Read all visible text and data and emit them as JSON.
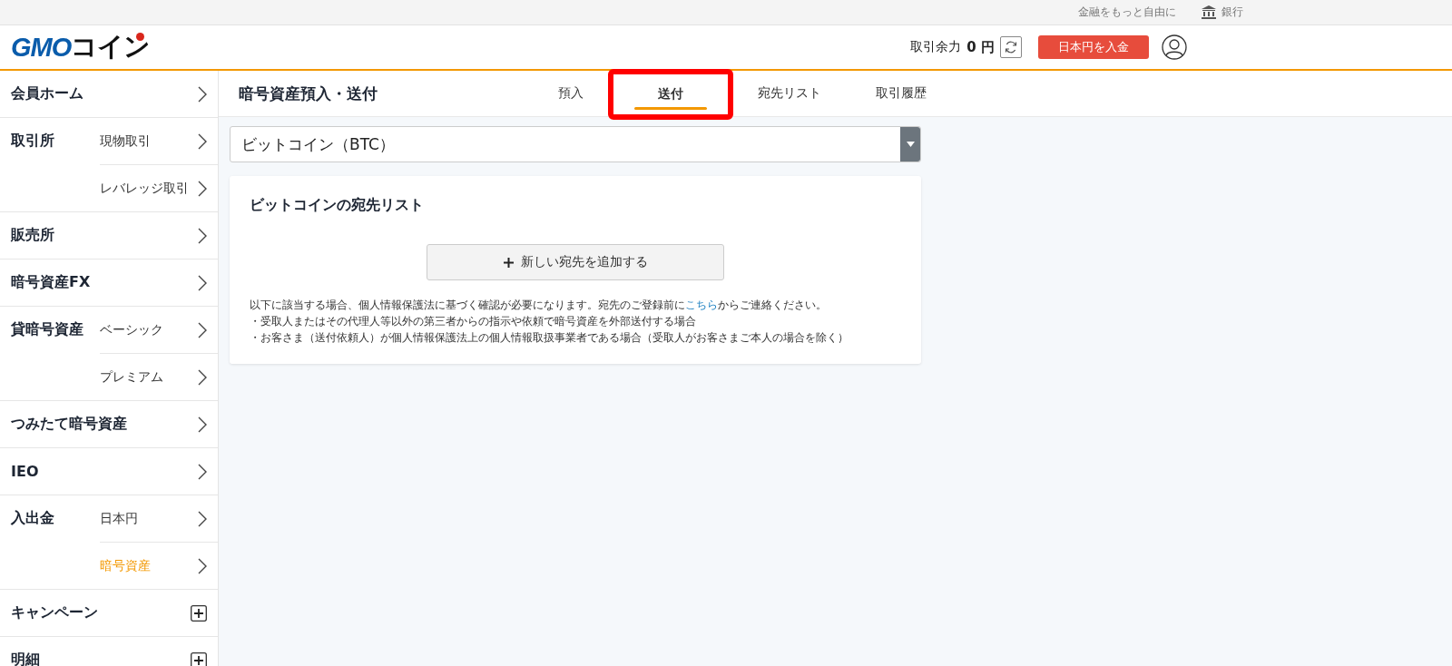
{
  "top_bar": {
    "tagline": "金融をもっと自由に",
    "bank_link": "銀行"
  },
  "header": {
    "logo": {
      "brand": "GMO",
      "name": "コイン"
    },
    "balance_label": "取引余力",
    "balance_value": "0 円",
    "deposit_button": "日本円を入金"
  },
  "sidebar": [
    {
      "label": "会員ホーム",
      "kind": "link"
    },
    {
      "label": "取引所",
      "kind": "group",
      "children": [
        {
          "label": "現物取引",
          "selected": false
        },
        {
          "label": "レバレッジ取引",
          "selected": false
        }
      ]
    },
    {
      "label": "販売所",
      "kind": "link"
    },
    {
      "label": "暗号資産FX",
      "kind": "link"
    },
    {
      "label": "貸暗号資産",
      "kind": "group",
      "children": [
        {
          "label": "ベーシック",
          "selected": false
        },
        {
          "label": "プレミアム",
          "selected": false
        }
      ]
    },
    {
      "label": "つみたて暗号資産",
      "kind": "link"
    },
    {
      "label": "IEO",
      "kind": "link"
    },
    {
      "label": "入出金",
      "kind": "group",
      "children": [
        {
          "label": "日本円",
          "selected": false
        },
        {
          "label": "暗号資産",
          "selected": true
        }
      ]
    },
    {
      "label": "キャンペーン",
      "kind": "expand"
    },
    {
      "label": "明細",
      "kind": "expand"
    }
  ],
  "page_title": "暗号資産預入・送付",
  "tabs": [
    {
      "label": "預入",
      "selected": false,
      "highlighted": false
    },
    {
      "label": "送付",
      "selected": true,
      "highlighted": true
    },
    {
      "label": "宛先リスト",
      "selected": false,
      "highlighted": false
    },
    {
      "label": "取引履歴",
      "selected": false,
      "highlighted": false
    }
  ],
  "currency_select": {
    "value": "ビットコイン（BTC）"
  },
  "card": {
    "title": "ビットコインの宛先リスト",
    "add_button": "新しい宛先を追加する",
    "notice": {
      "before": "以下に該当する場合、個人情報保護法に基づく確認が必要になります。宛先のご登録前に",
      "link": "こちら",
      "after": "からご連絡ください。"
    },
    "bullets": [
      "・受取人またはその代理人等以外の第三者からの指示や依頼で暗号資産を外部送付する場合",
      "・お客さま（送付依頼人）が個人情報保護法上の個人情報取扱事業者である場合（受取人がお客さまご本人の場合を除く）"
    ]
  }
}
